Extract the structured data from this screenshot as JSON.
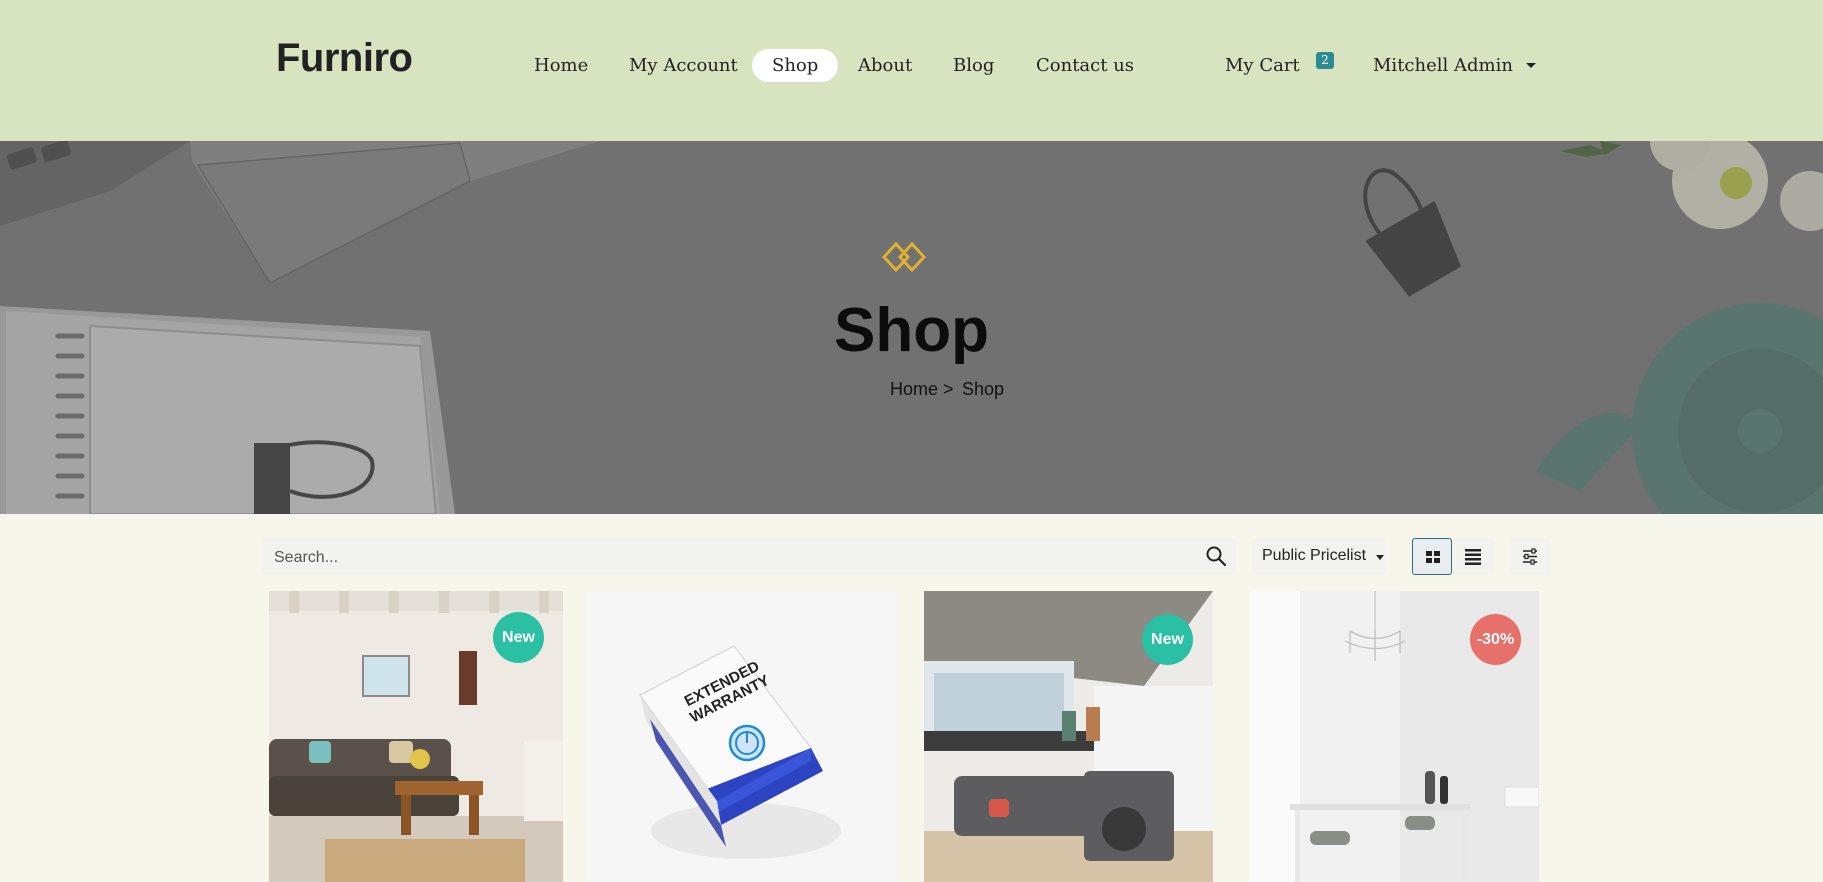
{
  "brand": "Furniro",
  "nav": {
    "items": [
      "Home",
      "My Account",
      "Shop",
      "About",
      "Blog",
      "Contact us"
    ],
    "active": "Shop",
    "cart_label": "My Cart",
    "cart_count": "2",
    "user_name": "Mitchell Admin"
  },
  "hero": {
    "title": "Shop",
    "breadcrumb_home": "Home >",
    "breadcrumb_current": "Shop",
    "accent_color": "#e0b02e"
  },
  "toolbar": {
    "search_placeholder": "Search...",
    "pricelist_label": "Public Pricelist"
  },
  "products": [
    {
      "badge": "New",
      "badge_color": "#2bbfa3",
      "image": "living-room-sofa"
    },
    {
      "badge": "",
      "badge_color": "",
      "image": "extended-warranty-box"
    },
    {
      "badge": "New",
      "badge_color": "#2bbfa3",
      "image": "grey-corner-sofa"
    },
    {
      "badge": "-30%",
      "badge_color": "#e8706a",
      "image": "white-dining-room"
    }
  ],
  "warranty_box_text": "EXTENDED WARRANTY"
}
